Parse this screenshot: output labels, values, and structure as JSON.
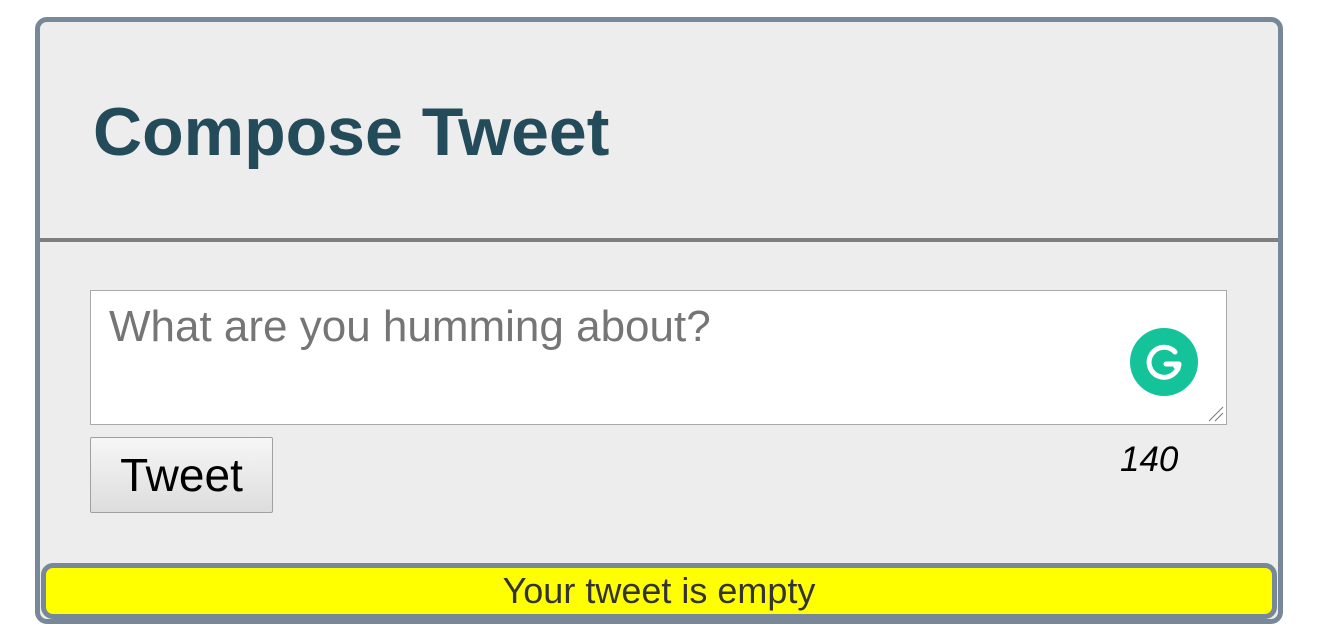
{
  "compose": {
    "title": "Compose Tweet",
    "textarea": {
      "placeholder": "What are you humming about?",
      "value": ""
    },
    "tweet_button_label": "Tweet",
    "char_counter": "140",
    "error_message": "Your tweet is empty"
  },
  "icons": {
    "grammarly": "grammarly-icon",
    "resize": "resize-handle-icon"
  },
  "colors": {
    "panel_border": "#778899",
    "panel_background": "#ededed",
    "title": "#244b5a",
    "error_background": "#ffff00",
    "grammarly": "#15c39a"
  }
}
